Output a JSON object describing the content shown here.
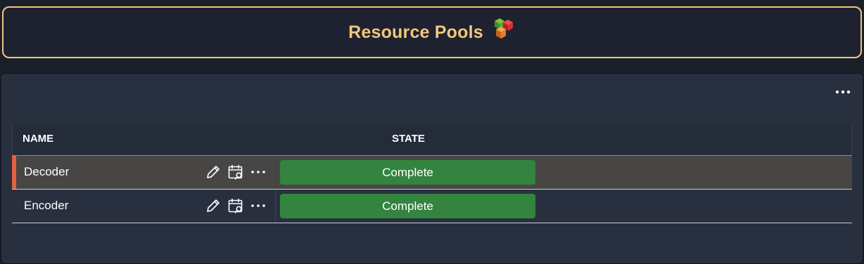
{
  "header": {
    "title": "Resource Pools",
    "icon": "cubes-icon"
  },
  "panel": {
    "more_icon": "more-horizontal-icon",
    "table": {
      "columns": [
        "NAME",
        "STATE"
      ],
      "rows": [
        {
          "name": "Decoder",
          "state": "Complete",
          "selected": true
        },
        {
          "name": "Encoder",
          "state": "Complete",
          "selected": false
        }
      ],
      "row_actions": [
        "edit-icon",
        "calendar-search-icon",
        "more-horizontal-icon"
      ]
    }
  },
  "colors": {
    "accent": "#f4c67b",
    "status_complete": "#33843f",
    "selection_marker": "#e2603f"
  }
}
